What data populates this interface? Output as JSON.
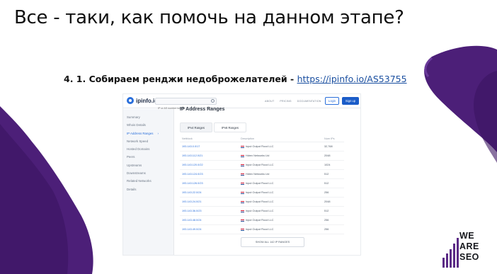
{
  "slide": {
    "title": "Все - таки, как помочь на данном этапе?",
    "subtitle_prefix": "4. 1. Собираем ренджи недоброжелателей - ",
    "subtitle_link": "https://ipinfo.io/AS53755"
  },
  "colors": {
    "brand_purple": "#5b2a86",
    "accent_blue": "#2a6fdb"
  },
  "app": {
    "logo_text": "ipinfo.io",
    "search_placeholder": "IP or AS number lookup",
    "nav": [
      "ABOUT",
      "PRICING",
      "DOCUMENTATION"
    ],
    "login_label": "Login",
    "signup_label": "Sign up"
  },
  "sidebar": {
    "items": [
      {
        "label": "Summary"
      },
      {
        "label": "Whois Details"
      },
      {
        "label": "IP Address Ranges",
        "active": true
      },
      {
        "label": "Network Speed"
      },
      {
        "label": "Hosted Domains"
      },
      {
        "label": "Peers"
      },
      {
        "label": "Upstreams"
      },
      {
        "label": "Downstreams"
      },
      {
        "label": "Related Networks"
      },
      {
        "label": "Details"
      }
    ]
  },
  "main": {
    "section_title": "IP Address Ranges",
    "tabs": [
      {
        "label": "IPv4 Ranges",
        "active": true
      },
      {
        "label": "IPv6 Ranges",
        "active": false
      }
    ],
    "columns": [
      "Netblock",
      "Description",
      "Num IPs"
    ],
    "rows": [
      {
        "netblock": "193.143.0.0/17",
        "description": "Input Output Flood LLC",
        "num": "32,768"
      },
      {
        "netblock": "193.143.112.0/21",
        "description": "Hdrex Networks Ltd",
        "num": "2048"
      },
      {
        "netblock": "193.143.120.0/22",
        "description": "Input Output Flood LLC",
        "num": "1024"
      },
      {
        "netblock": "193.143.124.0/23",
        "description": "Hdrex Networks Ltd",
        "num": "512"
      },
      {
        "netblock": "193.143.126.0/23",
        "description": "Input Output Flood LLC",
        "num": "512"
      },
      {
        "netblock": "193.143.22.0/24",
        "description": "Input Output Flood LLC",
        "num": "256"
      },
      {
        "netblock": "193.143.24.0/21",
        "description": "Input Output Flood LLC",
        "num": "2048"
      },
      {
        "netblock": "193.143.36.0/23",
        "description": "Input Output Flood LLC",
        "num": "512"
      },
      {
        "netblock": "193.143.48.0/24",
        "description": "Input Output Flood LLC",
        "num": "256"
      },
      {
        "netblock": "193.143.49.0/24",
        "description": "Input Output Flood LLC",
        "num": "256"
      }
    ],
    "show_all_label": "SHOW ALL 142 IP RANGES"
  },
  "brand": {
    "lines": [
      "WE",
      "ARE",
      "SEO"
    ]
  }
}
